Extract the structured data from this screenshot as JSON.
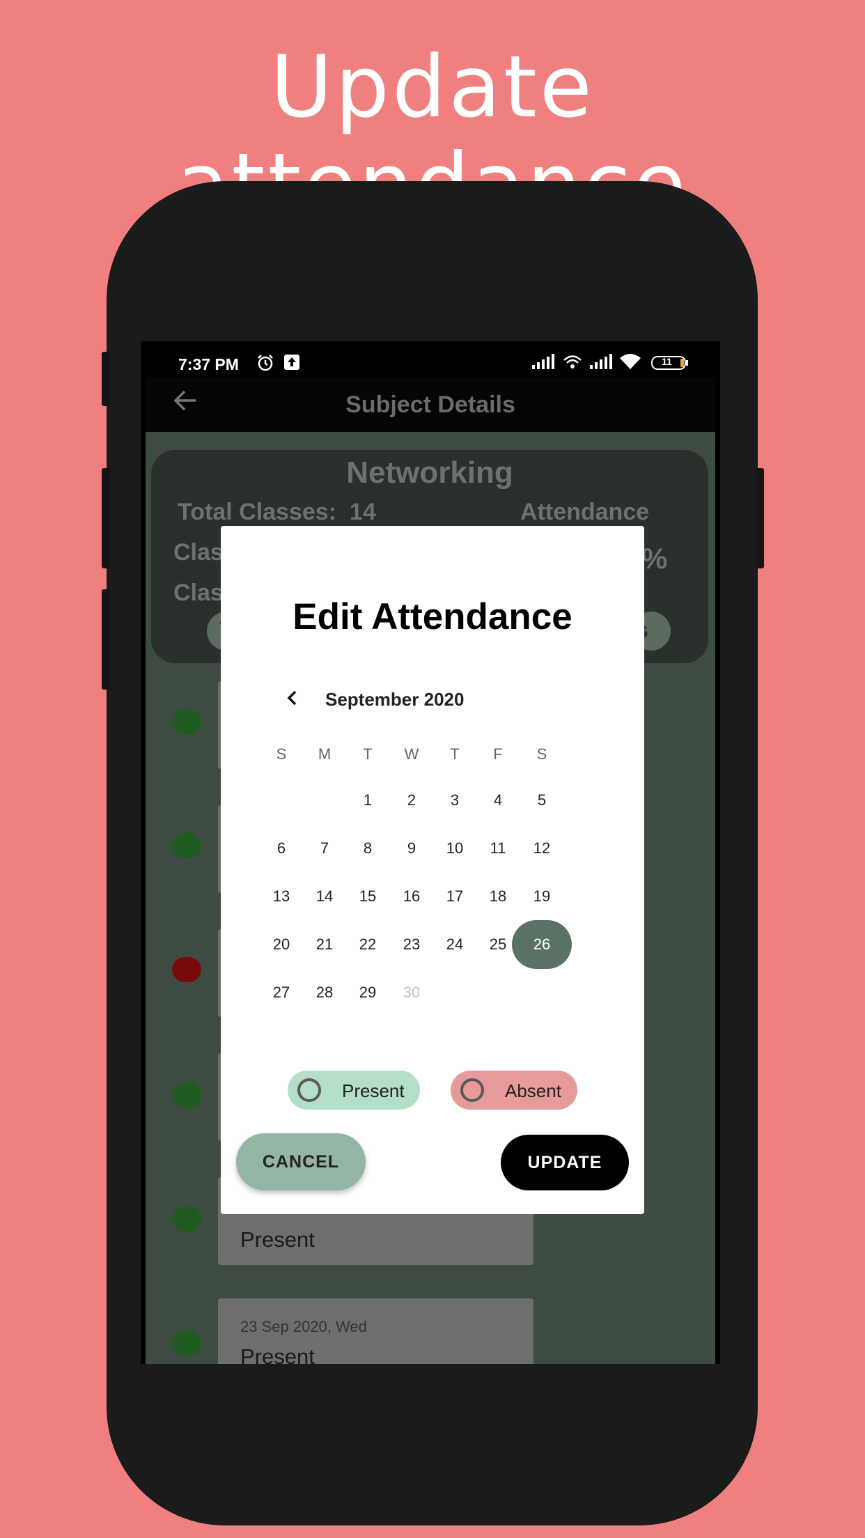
{
  "promo": {
    "title": "Update attendance"
  },
  "statusbar": {
    "time": "7:37 PM",
    "battery": "11"
  },
  "appbar": {
    "title": "Subject Details",
    "back_icon": "arrow-left-icon"
  },
  "summary": {
    "subject": "Networking",
    "total_classes_label": "Total Classes:",
    "total_classes_value": "14",
    "attendance_label": "Attendance",
    "row2_left": "Clas",
    "row2_right": "%",
    "row3_left": "Clas",
    "pill_left_text": "V",
    "pill_right_text": "s"
  },
  "records": [
    {
      "status_color": "green"
    },
    {
      "status_color": "green"
    },
    {
      "status_color": "red"
    },
    {
      "status_color": "green"
    },
    {
      "status_color": "green",
      "status": "Present"
    },
    {
      "status_color": "green",
      "date": "23 Sep 2020, Wed",
      "status": "Present"
    }
  ],
  "dialog": {
    "title": "Edit Attendance",
    "calendar": {
      "month_label": "September 2020",
      "weekdays": [
        "S",
        "M",
        "T",
        "W",
        "T",
        "F",
        "S"
      ],
      "weeks": [
        [
          "",
          "",
          "1",
          "2",
          "3",
          "4",
          "5"
        ],
        [
          "6",
          "7",
          "8",
          "9",
          "10",
          "11",
          "12"
        ],
        [
          "13",
          "14",
          "15",
          "16",
          "17",
          "18",
          "19"
        ],
        [
          "20",
          "21",
          "22",
          "23",
          "24",
          "25",
          "26"
        ],
        [
          "27",
          "28",
          "29",
          "30",
          "",
          "",
          ""
        ]
      ],
      "selected_day": "26",
      "disabled_days": [
        "30"
      ]
    },
    "options": {
      "present_label": "Present",
      "absent_label": "Absent",
      "present_color": "#b3dec7",
      "absent_color": "#e69a9a"
    },
    "cancel_label": "CANCEL",
    "update_label": "UPDATE"
  },
  "colors": {
    "background": "#f08080",
    "selected_day": "#5a7264",
    "cancel_button": "#95b5a4",
    "update_button": "#000000"
  }
}
